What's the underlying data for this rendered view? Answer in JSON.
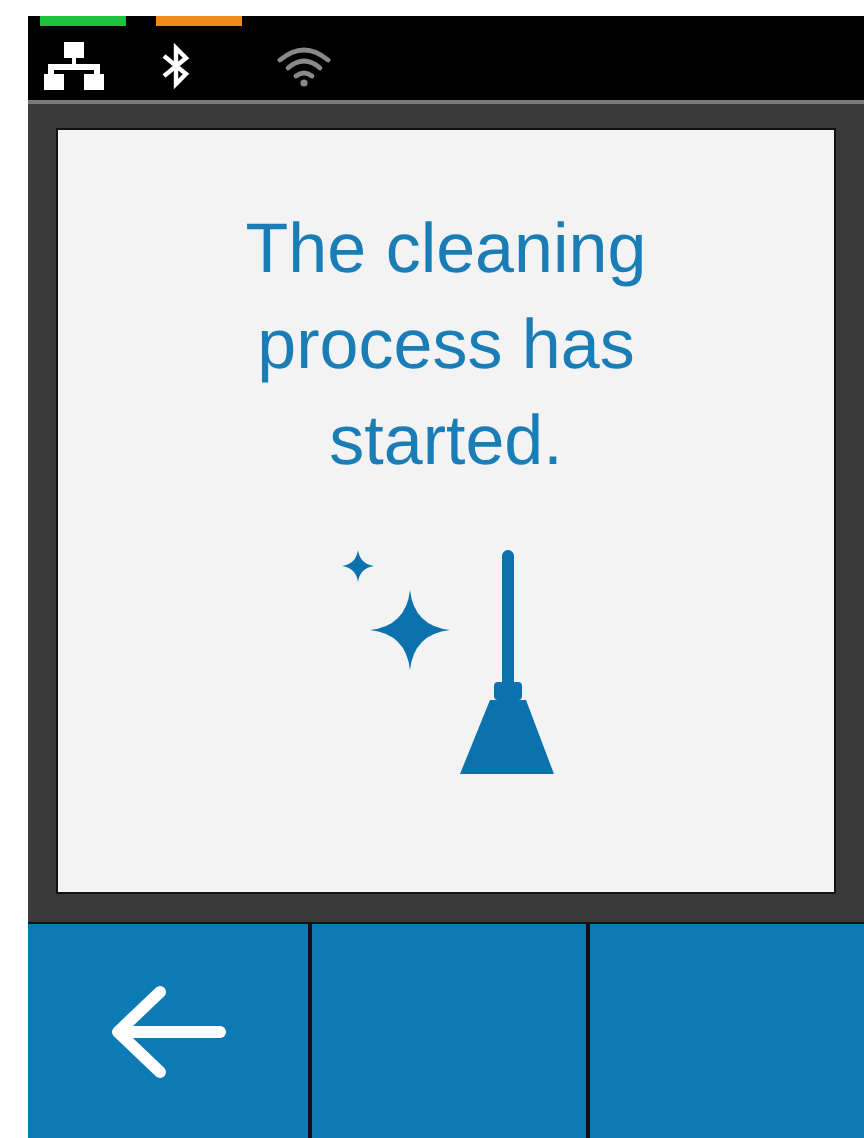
{
  "status_bar": {
    "icons": [
      {
        "kind": "network",
        "on": true,
        "color": "#1fc23f"
      },
      {
        "kind": "bluetooth",
        "on": true,
        "color": "#f28a1a"
      },
      {
        "kind": "wifi",
        "on": false
      }
    ]
  },
  "message": {
    "text": "The cleaning process has started.",
    "kind": "cleaning"
  },
  "buttons": [
    {
      "kind": "back"
    },
    {
      "kind": "blank"
    },
    {
      "kind": "blank"
    }
  ]
}
